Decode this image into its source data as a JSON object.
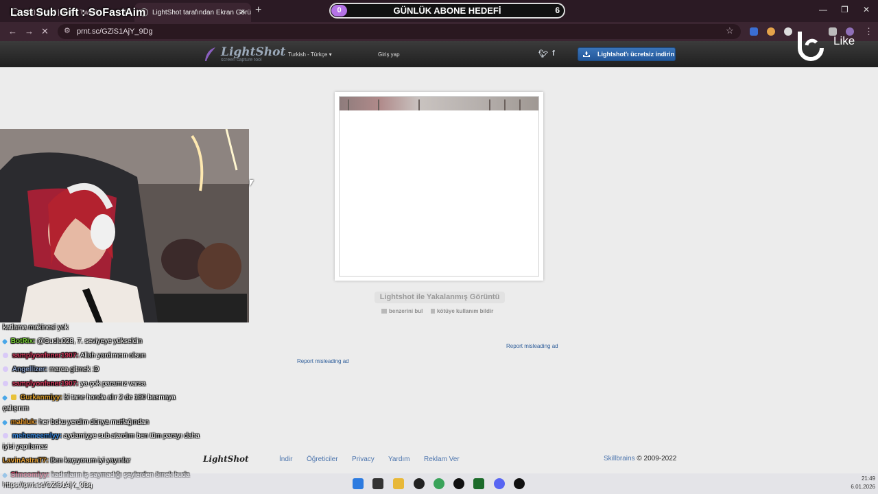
{
  "browser": {
    "tabs": [
      {
        "title": "(39) Mesaj | Kick | Twitch..."
      },
      {
        "title": "LightShot tarafından Ekran Görüntü"
      }
    ],
    "url": "prnt.sc/GZiS1AjY_9Dg",
    "status_url": "https://prnt.sc/GZiS1AjY_9Dg"
  },
  "stream_overlay": {
    "last_sub_gift": "Last Sub Gift : SoFastAim",
    "goal": {
      "title": "GÜNLÜK ABONE HEDEFİ",
      "current": "0",
      "target": "6"
    },
    "like_text": "Like"
  },
  "lightshot": {
    "logo_name": "LightShot",
    "logo_tagline": "screen capture tool",
    "language": "Turkish - Türkçe",
    "login": "Giriş yap",
    "twitter_icon": "twitter-icon",
    "facebook_label": "f",
    "download_button": "Lightshot'ı ücretsiz indirin",
    "caption": "Lightshot ile Yakalanmış Görüntü",
    "find_similar": "benzerini bul",
    "report_abuse": "kötüye kullanım bildir",
    "report_ad_1": "Report misleading ad",
    "report_ad_2": "Report misleading ad",
    "footer": {
      "logo": "LightShot",
      "links": [
        "İndir",
        "Öğreticiler",
        "Privacy",
        "Yardım",
        "Reklam Ver"
      ],
      "copyright_link": "Skillbrains",
      "copyright_rest": "© 2009-2022"
    }
  },
  "chat": [
    {
      "user": "",
      "text": "katlama makinesi yok",
      "color": "#ffffff"
    },
    {
      "user": "BotRix:",
      "text": "@Guclu028, 7. seviyeye yükseldin",
      "color": "#7cd63a"
    },
    {
      "user": "samplyonfener1907:",
      "text": "Allah yardımcın olsun",
      "color": "#d23a5e"
    },
    {
      "user": "Angellizer:",
      "text": "marca gitmek :D",
      "color": "#8aa0c8"
    },
    {
      "user": "samplyonfener1907:",
      "text": "ya çok paramız varsa",
      "color": "#d23a5e"
    },
    {
      "user": "Gurkanmiyy:",
      "text": "bi tane honda alır 2 de 180 basmaya",
      "text2": "çalışırım",
      "color": "#e0a22f"
    },
    {
      "user": "mahluk:",
      "text": "her boku yerdim dünya mutfağından",
      "color": "#f0a030"
    },
    {
      "user": "mehemeemlyy:",
      "text": "aydamiyye sub atardım ben tüm parayı daha",
      "text2": "iyisi yapılamaz",
      "color": "#3a8ae0"
    },
    {
      "user": "LavinAstraT7:",
      "text": "Ben kaçıyorum iyi yayınlar",
      "color": "#e8a43a"
    },
    {
      "user": "Slmcomiyy:",
      "text": "kadınların iş saymadığı şeylerden örnek buda",
      "color": "#d23a5e"
    }
  ],
  "taskbar": {
    "time": "21:49",
    "date": "6.01.2026"
  },
  "colors": {
    "accent_blue": "#2f5e9a",
    "goal_purple": "#b473e6"
  }
}
